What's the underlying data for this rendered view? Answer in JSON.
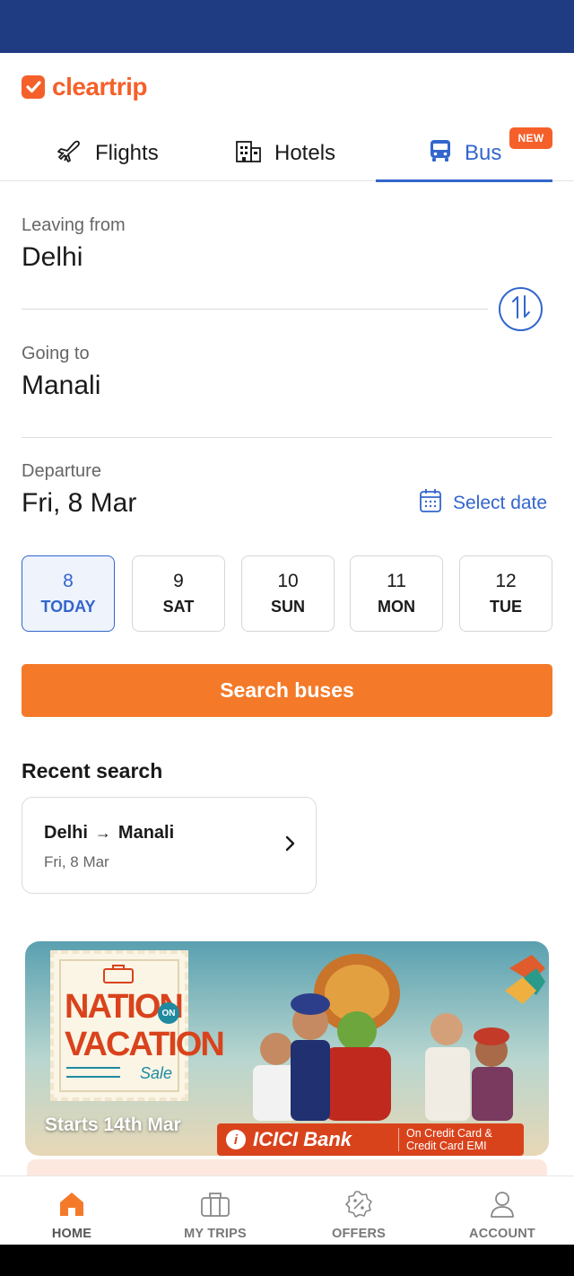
{
  "app": {
    "brand": "cleartrip",
    "accent": "#f5602a",
    "primary": "#3366cc"
  },
  "tabs": [
    {
      "label": "Flights",
      "icon": "plane-icon"
    },
    {
      "label": "Hotels",
      "icon": "building-icon"
    },
    {
      "label": "Bus",
      "icon": "bus-icon",
      "active": true,
      "badge": "NEW"
    }
  ],
  "form": {
    "leaving_label": "Leaving from",
    "leaving_value": "Delhi",
    "going_label": "Going to",
    "going_value": "Manali",
    "departure_label": "Departure",
    "departure_value": "Fri, 8 Mar",
    "select_date": "Select date"
  },
  "dates": [
    {
      "num": "8",
      "day": "TODAY",
      "selected": true
    },
    {
      "num": "9",
      "day": "SAT"
    },
    {
      "num": "10",
      "day": "SUN"
    },
    {
      "num": "11",
      "day": "MON"
    },
    {
      "num": "12",
      "day": "TUE"
    }
  ],
  "search_button": "Search buses",
  "recent": {
    "title": "Recent search",
    "from": "Delhi",
    "arrow": "→",
    "to": "Manali",
    "date": "Fri, 8 Mar"
  },
  "banner": {
    "stamp_line1": "NATION",
    "stamp_on": "ON",
    "stamp_line2": "VACATION",
    "stamp_sale": "Sale",
    "starts": "Starts 14th Mar",
    "bank_name": "ICICI Bank",
    "bank_terms_1": "On Credit Card &",
    "bank_terms_2": "Credit Card EMI"
  },
  "bottom_nav": [
    {
      "label": "HOME",
      "icon": "home-icon",
      "active": true
    },
    {
      "label": "MY TRIPS",
      "icon": "briefcase-icon"
    },
    {
      "label": "OFFERS",
      "icon": "offer-badge-icon"
    },
    {
      "label": "ACCOUNT",
      "icon": "user-icon"
    }
  ]
}
